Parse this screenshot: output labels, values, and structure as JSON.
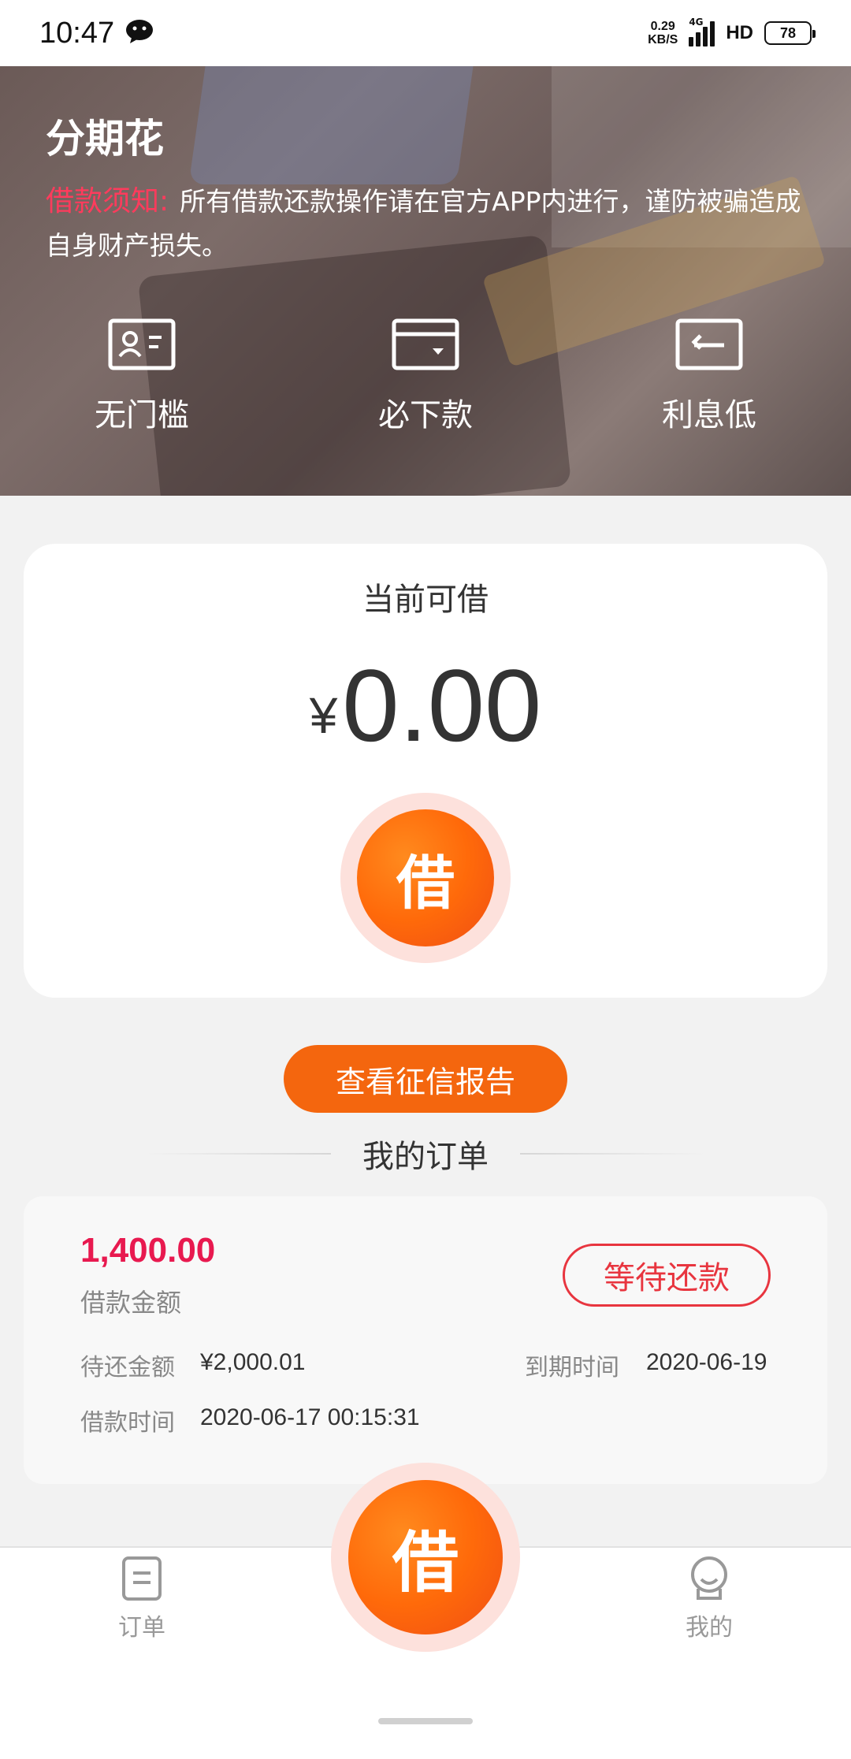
{
  "status_bar": {
    "time": "10:47",
    "net_speed_top": "0.29",
    "net_speed_bottom": "KB/S",
    "network": "4G",
    "hd": "HD",
    "battery": "78"
  },
  "hero": {
    "title": "分期花",
    "notice_label": "借款须知:",
    "notice_text": "所有借款还款操作请在官方APP内进行，谨防被骗造成自身财产损失。",
    "features": [
      {
        "label": "无门槛",
        "icon": "id-card-icon"
      },
      {
        "label": "必下款",
        "icon": "wallet-icon"
      },
      {
        "label": "利息低",
        "icon": "return-icon"
      }
    ]
  },
  "loan_card": {
    "available_label": "当前可借",
    "currency": "¥",
    "amount": "0.00",
    "borrow_button": "借"
  },
  "credit_report_button": "查看征信报告",
  "orders": {
    "title": "我的订单",
    "items": [
      {
        "amount": "1,400.00",
        "amount_label": "借款金额",
        "status": "等待还款",
        "due_amount_label": "待还金额",
        "due_amount": "¥2,000.01",
        "due_date_label": "到期时间",
        "due_date": "2020-06-19",
        "loan_time_label": "借款时间",
        "loan_time": "2020-06-17 00:15:31"
      }
    ]
  },
  "bottom_nav": {
    "orders_label": "订单",
    "center_button": "借",
    "mine_label": "我的"
  },
  "colors": {
    "accent_orange": "#f4660e",
    "amount_red": "#e8194f",
    "badge_red": "#e8353f",
    "notice_red": "#ff3b5c"
  }
}
